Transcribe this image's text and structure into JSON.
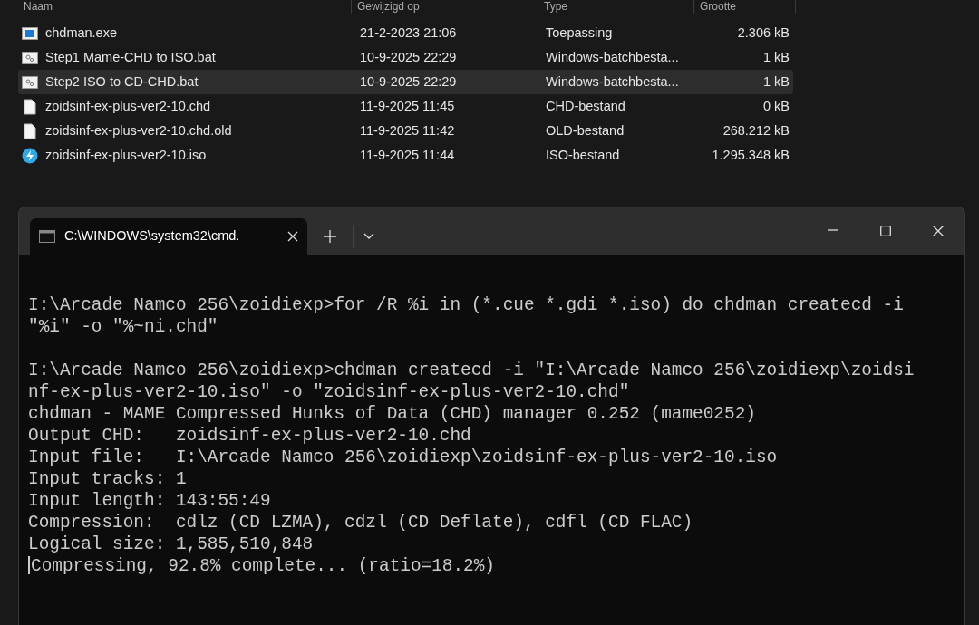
{
  "explorer": {
    "columns": [
      "Naam",
      "Gewijzigd op",
      "Type",
      "Grootte"
    ],
    "files": [
      {
        "kind": "exe",
        "name": "chdman.exe",
        "modified": "21-2-2023 21:06",
        "type": "Toepassing",
        "size": "2.306 kB",
        "selected": false
      },
      {
        "kind": "bat",
        "name": "Step1 Mame-CHD to ISO.bat",
        "modified": "10-9-2025 22:29",
        "type": "Windows-batchbesta...",
        "size": "1 kB",
        "selected": false
      },
      {
        "kind": "bat",
        "name": "Step2 ISO to CD-CHD.bat",
        "modified": "10-9-2025 22:29",
        "type": "Windows-batchbesta...",
        "size": "1 kB",
        "selected": true
      },
      {
        "kind": "file",
        "name": "zoidsinf-ex-plus-ver2-10.chd",
        "modified": "11-9-2025 11:45",
        "type": "CHD-bestand",
        "size": "0 kB",
        "selected": false
      },
      {
        "kind": "file",
        "name": "zoidsinf-ex-plus-ver2-10.chd.old",
        "modified": "11-9-2025 11:42",
        "type": "OLD-bestand",
        "size": "268.212 kB",
        "selected": false
      },
      {
        "kind": "iso",
        "name": "zoidsinf-ex-plus-ver2-10.iso",
        "modified": "11-9-2025 11:44",
        "type": "ISO-bestand",
        "size": "1.295.348 kB",
        "selected": false
      }
    ]
  },
  "terminal": {
    "tab": {
      "title": "C:\\WINDOWS\\system32\\cmd."
    },
    "cursor": true,
    "blocks": [
      {
        "lines": [
          "I:\\Arcade Namco 256\\zoidiexp>for /R %i in (*.cue *.gdi *.iso) do chdman createcd -i",
          "\"%i\" -o \"%~ni.chd\""
        ]
      },
      {
        "lines": [
          "I:\\Arcade Namco 256\\zoidiexp>chdman createcd -i \"I:\\Arcade Namco 256\\zoidiexp\\zoidsi",
          "nf-ex-plus-ver2-10.iso\" -o \"zoidsinf-ex-plus-ver2-10.chd\"",
          "chdman - MAME Compressed Hunks of Data (CHD) manager 0.252 (mame0252)",
          "Output CHD:   zoidsinf-ex-plus-ver2-10.chd",
          "Input file:   I:\\Arcade Namco 256\\zoidiexp\\zoidsinf-ex-plus-ver2-10.iso",
          "Input tracks: 1",
          "Input length: 143:55:49",
          "Compression:  cdlz (CD LZMA), cdzl (CD Deflate), cdfl (CD FLAC)",
          "Logical size: 1,585,510,848",
          "Compressing, 92.8% complete... (ratio=18.2%)"
        ]
      }
    ]
  }
}
